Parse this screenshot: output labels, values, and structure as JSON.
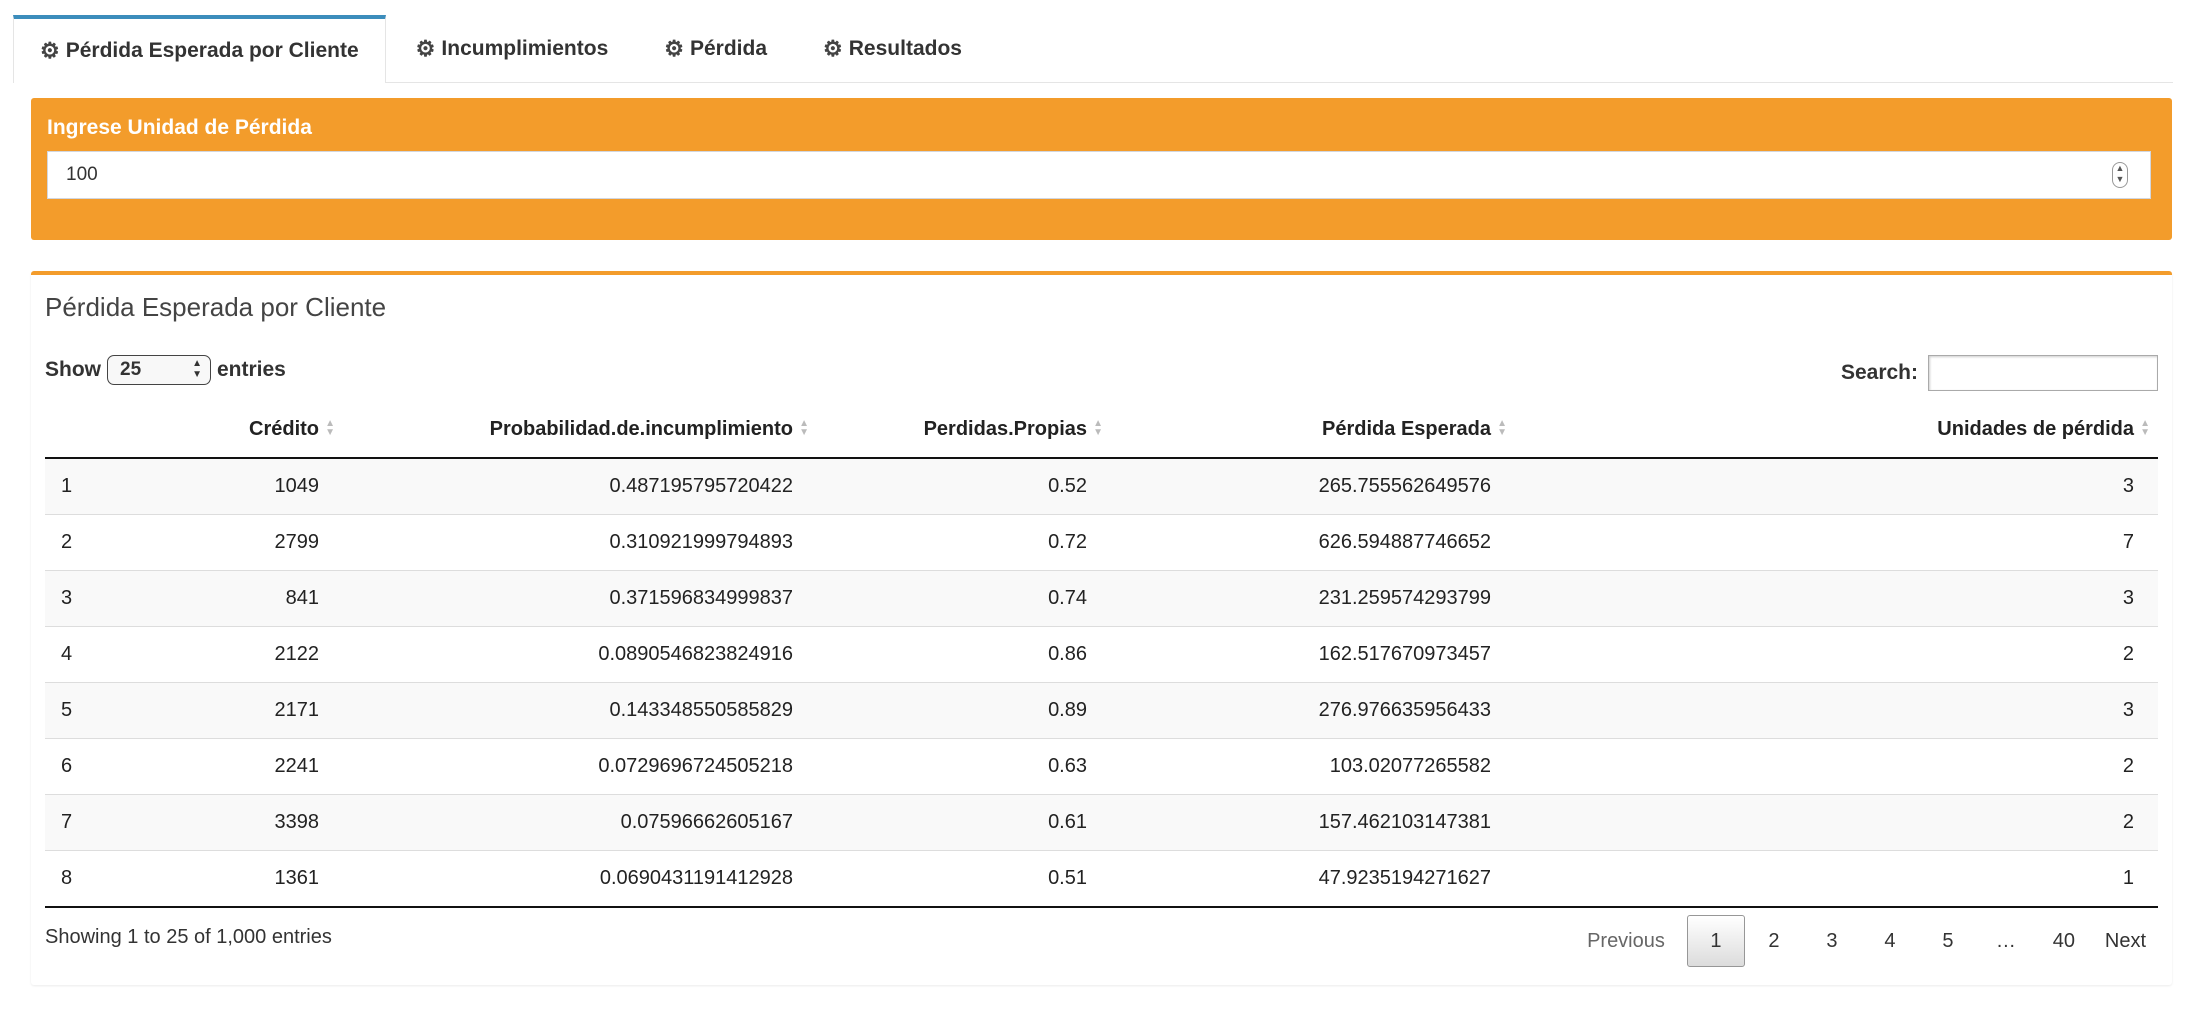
{
  "tabs": [
    {
      "label": "Pérdida Esperada por Cliente",
      "icon": "gear-icon",
      "active": true
    },
    {
      "label": "Incumplimientos",
      "icon": "gear-icon",
      "active": false
    },
    {
      "label": "Pérdida",
      "icon": "gear-icon",
      "active": false
    },
    {
      "label": "Resultados",
      "icon": "gear-icon",
      "active": false
    }
  ],
  "input_box": {
    "label": "Ingrese Unidad de Pérdida",
    "value": "100",
    "color": "#f39c2b"
  },
  "result_box": {
    "title": "Pérdida Esperada por Cliente",
    "show_label": "Show",
    "entries_value": "25",
    "entries_label": "entries",
    "search_label": "Search:",
    "search_value": ""
  },
  "table": {
    "columns": [
      "",
      "Crédito",
      "Probabilidad.de.incumplimiento",
      "Perdidas.Propias",
      "Pérdida Esperada",
      "Unidades de pérdida"
    ],
    "rows": [
      [
        "1",
        "1049",
        "0.487195795720422",
        "0.52",
        "265.755562649576",
        "3"
      ],
      [
        "2",
        "2799",
        "0.310921999794893",
        "0.72",
        "626.594887746652",
        "7"
      ],
      [
        "3",
        "841",
        "0.371596834999837",
        "0.74",
        "231.259574293799",
        "3"
      ],
      [
        "4",
        "2122",
        "0.0890546823824916",
        "0.86",
        "162.517670973457",
        "2"
      ],
      [
        "5",
        "2171",
        "0.143348550585829",
        "0.89",
        "276.976635956433",
        "3"
      ],
      [
        "6",
        "2241",
        "0.0729696724505218",
        "0.63",
        "103.02077265582",
        "2"
      ],
      [
        "7",
        "3398",
        "0.07596662605167",
        "0.61",
        "157.462103147381",
        "2"
      ],
      [
        "8",
        "1361",
        "0.0690431191412928",
        "0.51",
        "47.9235194271627",
        "1"
      ]
    ]
  },
  "footer": {
    "info": "Showing 1 to 25 of 1,000 entries",
    "previous": "Previous",
    "pages": [
      "1",
      "2",
      "3",
      "4",
      "5",
      "…",
      "40"
    ],
    "active_page": "1",
    "next": "Next"
  }
}
